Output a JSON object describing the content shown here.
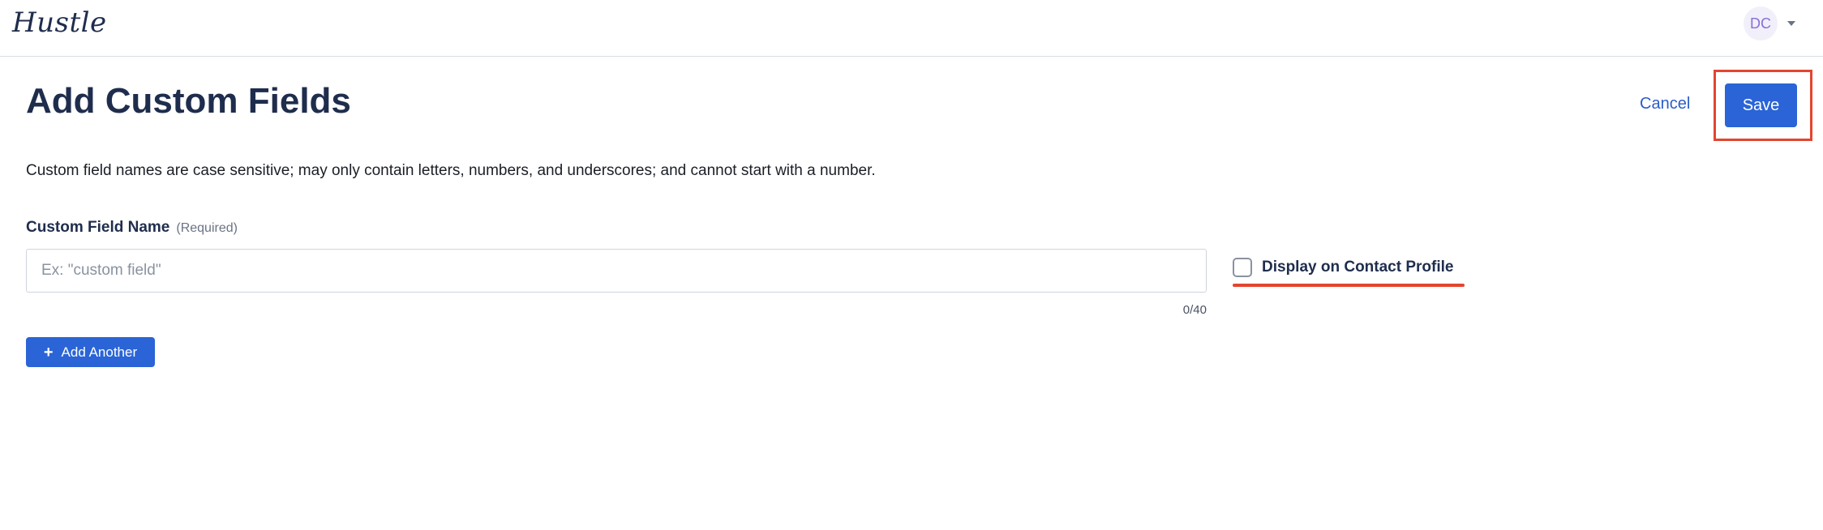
{
  "app": {
    "logo_text": "Hustle",
    "user_initials": "DC"
  },
  "header": {
    "title": "Add Custom Fields",
    "cancel_label": "Cancel",
    "save_label": "Save"
  },
  "description": "Custom field names are case sensitive; may only contain letters, numbers, and underscores; and cannot start with a number.",
  "field": {
    "label": "Custom Field Name",
    "required_hint": "(Required)",
    "value": "",
    "placeholder": "Ex: \"custom field\"",
    "char_count": "0/40"
  },
  "display_option": {
    "label": "Display on Contact Profile",
    "checked": false
  },
  "add_another_label": "Add Another",
  "icons": {
    "plus": "plus-icon",
    "caret": "chevron-down-icon"
  },
  "colors": {
    "primary": "#2a64d6",
    "link": "#2a5dc8",
    "highlight": "#e3452f",
    "text": "#1f2d4d",
    "avatar_bg": "#f1effa",
    "avatar_text": "#8a6fd8"
  }
}
